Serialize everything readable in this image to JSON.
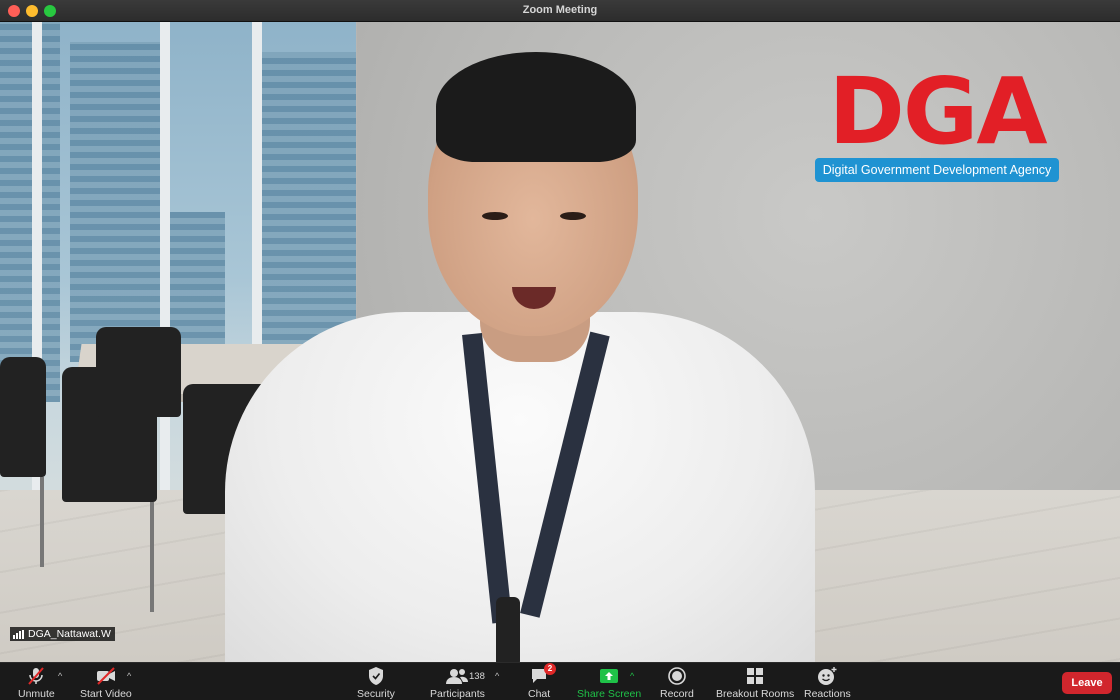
{
  "window": {
    "title": "Zoom Meeting"
  },
  "video": {
    "participant_name": "DGA_Nattawat.W",
    "logo": {
      "letters": "DGA",
      "tagline": "Digital Government Development Agency",
      "brand_red": "#e21f26",
      "brand_blue": "#1f93d2"
    }
  },
  "toolbar": {
    "unmute_label": "Unmute",
    "start_video_label": "Start Video",
    "security_label": "Security",
    "participants_label": "Participants",
    "participants_count": "138",
    "chat_label": "Chat",
    "chat_badge": "2",
    "share_screen_label": "Share Screen",
    "record_label": "Record",
    "breakout_rooms_label": "Breakout Rooms",
    "reactions_label": "Reactions",
    "leave_label": "Leave",
    "leave_color": "#d1262d",
    "share_color": "#1fc148"
  }
}
